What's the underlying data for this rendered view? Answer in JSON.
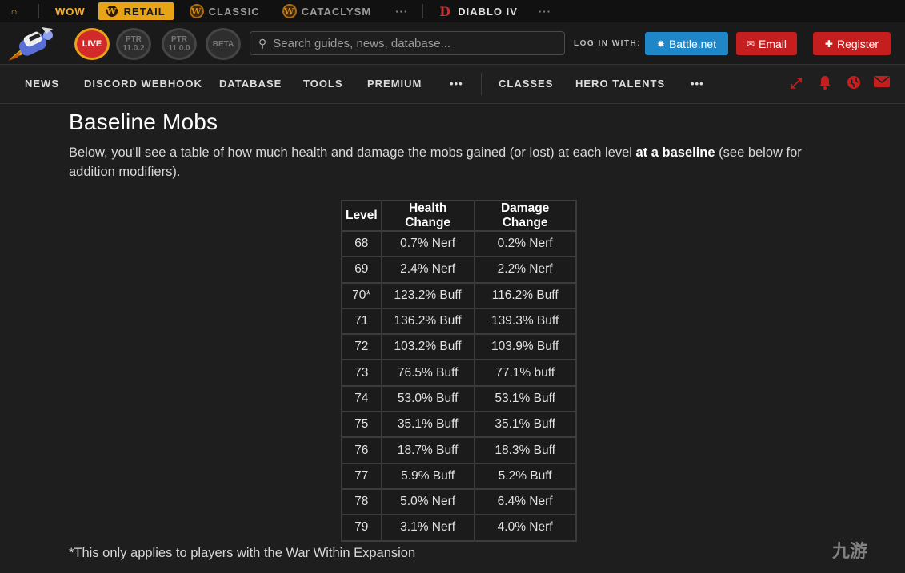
{
  "topbar": {
    "home_icon": "home-icon",
    "wow": "WOW",
    "retail": "RETAIL",
    "classic": "CLASSIC",
    "cataclysm": "CATACLYSM",
    "more1": "···",
    "diablo": "DIABLO IV",
    "more2": "···",
    "accent": "#e8a317"
  },
  "versions": {
    "live": "LIVE",
    "ptr1_a": "PTR",
    "ptr1_b": "11.0.2",
    "ptr2_a": "PTR",
    "ptr2_b": "11.0.0",
    "beta": "BETA"
  },
  "search": {
    "placeholder": "Search guides, news, database..."
  },
  "login": {
    "label": "LOG IN WITH:",
    "battlenet": "Battle.net",
    "email": "Email",
    "register": "Register"
  },
  "nav": {
    "items": [
      "NEWS",
      "DISCORD WEBHOOK",
      "DATABASE",
      "TOOLS",
      "PREMIUM",
      "•••",
      "CLASSES",
      "HERO TALENTS",
      "•••"
    ],
    "icons": [
      "expand-icon",
      "bell-icon",
      "globe-icon",
      "envelope-icon"
    ]
  },
  "content": {
    "title": "Baseline Mobs",
    "intro_before": "Below, you'll see a table of how much health and damage the mobs gained (or lost) at each level ",
    "intro_bold": "at a baseline",
    "intro_after": " (see below for addition modifiers).",
    "footnote": "*This only applies to players with the War Within Expansion"
  },
  "table": {
    "headers": [
      "Level",
      "Health Change",
      "Damage Change"
    ],
    "rows": [
      [
        "68",
        "0.7% Nerf",
        "0.2% Nerf"
      ],
      [
        "69",
        "2.4% Nerf",
        "2.2% Nerf"
      ],
      [
        "70*",
        "123.2% Buff",
        "116.2% Buff"
      ],
      [
        "71",
        "136.2% Buff",
        "139.3% Buff"
      ],
      [
        "72",
        "103.2% Buff",
        "103.9% Buff"
      ],
      [
        "73",
        "76.5% Buff",
        "77.1% buff"
      ],
      [
        "74",
        "53.0% Buff",
        "53.1% Buff"
      ],
      [
        "75",
        "35.1% Buff",
        "35.1% Buff"
      ],
      [
        "76",
        "18.7% Buff",
        "18.3% Buff"
      ],
      [
        "77",
        "5.9% Buff",
        "5.2% Buff"
      ],
      [
        "78",
        "5.0% Nerf",
        "6.4% Nerf"
      ],
      [
        "79",
        "3.1% Nerf",
        "4.0% Nerf"
      ]
    ]
  },
  "watermark": "九游"
}
